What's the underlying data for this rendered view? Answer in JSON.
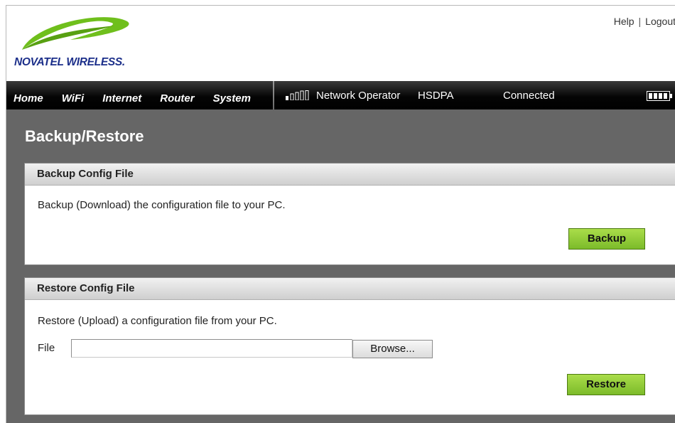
{
  "header": {
    "brand": "NOVATEL WIRELESS.",
    "links": {
      "help": "Help",
      "separator": "|",
      "logout": "Logout"
    }
  },
  "nav": {
    "items": [
      "Home",
      "WiFi",
      "Internet",
      "Router",
      "System"
    ],
    "operator": "Network Operator",
    "network_type": "HSDPA",
    "connection_status": "Connected",
    "signal_strength": "1 of 5 bars",
    "battery_icon": "battery-icon"
  },
  "page": {
    "title": "Backup/Restore",
    "backup": {
      "heading": "Backup Config File",
      "description": "Backup (Download) the configuration file to your PC.",
      "button": "Backup"
    },
    "restore": {
      "heading": "Restore Config File",
      "description": "Restore (Upload) a configuration file from your PC.",
      "file_label": "File",
      "file_value": "",
      "browse_button": "Browse...",
      "button": "Restore"
    }
  },
  "colors": {
    "content_bg": "#666666",
    "brand_blue": "#1c2f8a",
    "swoosh_green": "#6fbf1c",
    "button_green": "#8ccb35"
  }
}
